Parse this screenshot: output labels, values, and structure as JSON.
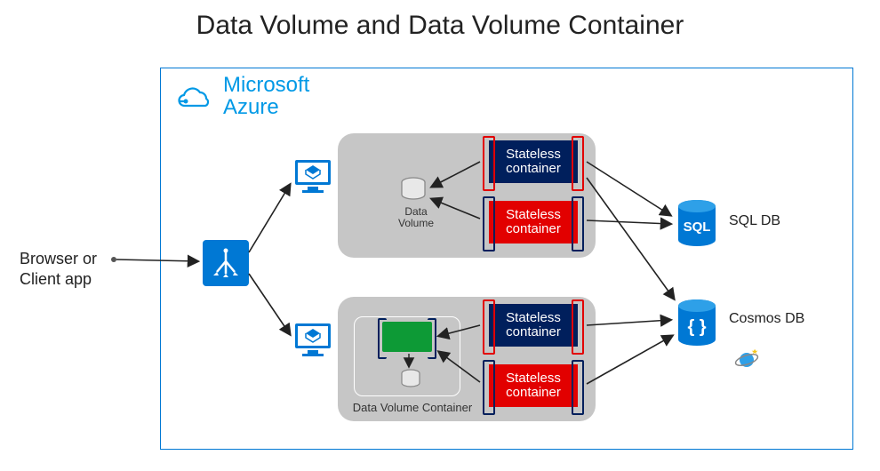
{
  "title": "Data Volume and Data Volume Container",
  "client_label_line1": "Browser or",
  "client_label_line2": "Client app",
  "azure": {
    "brand_line1": "Microsoft",
    "brand_line2": "Azure"
  },
  "groups": {
    "top": {
      "data_volume_label": "Data Volume",
      "containers": [
        {
          "label": "Stateless container",
          "color": "navy"
        },
        {
          "label": "Stateless container",
          "color": "red"
        }
      ]
    },
    "bottom": {
      "data_volume_container_label": "Data Volume  Container",
      "containers": [
        {
          "label": "Stateless container",
          "color": "navy"
        },
        {
          "label": "Stateless container",
          "color": "red"
        }
      ]
    }
  },
  "databases": {
    "sql": {
      "label": "SQL DB",
      "badge": "SQL"
    },
    "cosmos": {
      "label": "Cosmos DB",
      "badge": "{ }"
    }
  },
  "colors": {
    "azure_blue": "#0078d4",
    "azure_light": "#0099e6",
    "navy": "#001f5c",
    "red": "#e20000",
    "green": "#0d9a36",
    "grey": "#c6c6c6"
  }
}
